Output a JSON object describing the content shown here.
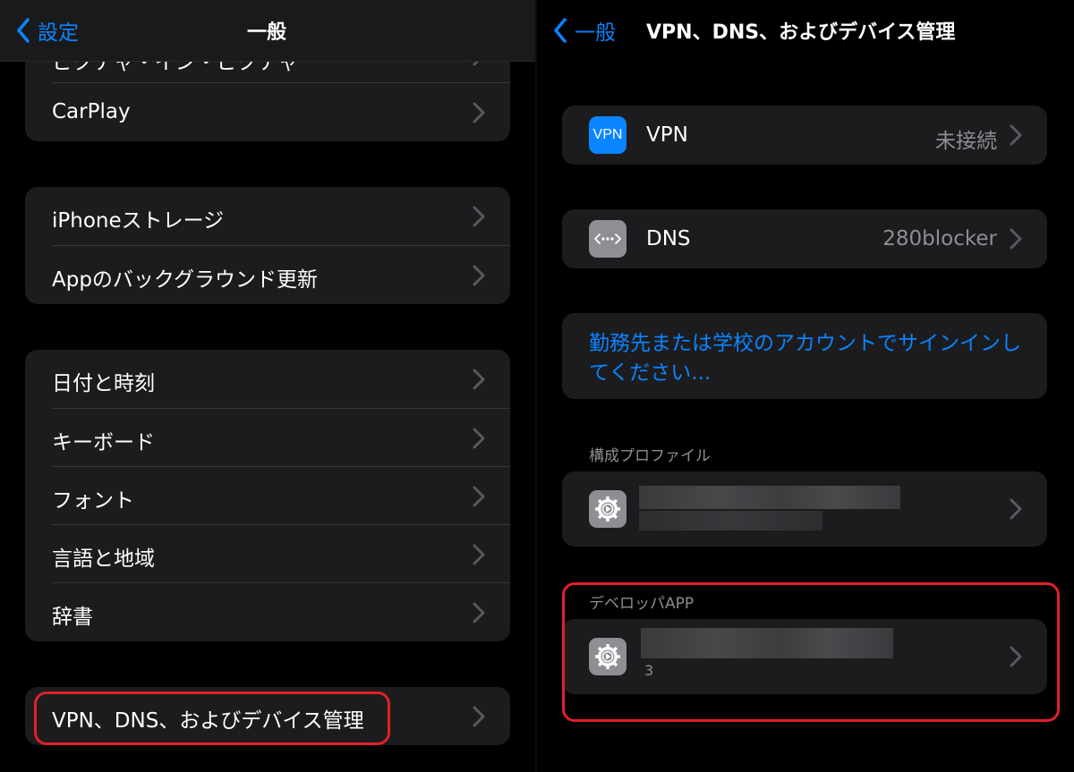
{
  "left": {
    "back_label": "設定",
    "title": "一般",
    "peek_row": "ピクチャ・イン・ピクチャ",
    "carplay": "CarPlay",
    "storage_group": [
      "iPhoneストレージ",
      "Appのバックグラウンド更新"
    ],
    "locale_group": [
      "日付と時刻",
      "キーボード",
      "フォント",
      "言語と地域",
      "辞書"
    ],
    "vpn_row": "VPN、DNS、およびデバイス管理"
  },
  "right": {
    "back_label": "一般",
    "title": "VPN、DNS、およびデバイス管理",
    "vpn": {
      "icon_text": "VPN",
      "label": "VPN",
      "value": "未接続"
    },
    "dns": {
      "label": "DNS",
      "value": "280blocker"
    },
    "signin_link": "勤務先または学校のアカウントでサインインしてください...",
    "profile_header": "構成プロファイル",
    "developer_header": "デベロッパAPP",
    "developer_subtext": "3"
  },
  "colors": {
    "accent": "#0a84ff",
    "group_bg": "#1c1c1e",
    "highlight": "#e0202a",
    "vpn_icon_bg": "#0a84ff",
    "gray_icon_bg": "#8e8e93"
  }
}
